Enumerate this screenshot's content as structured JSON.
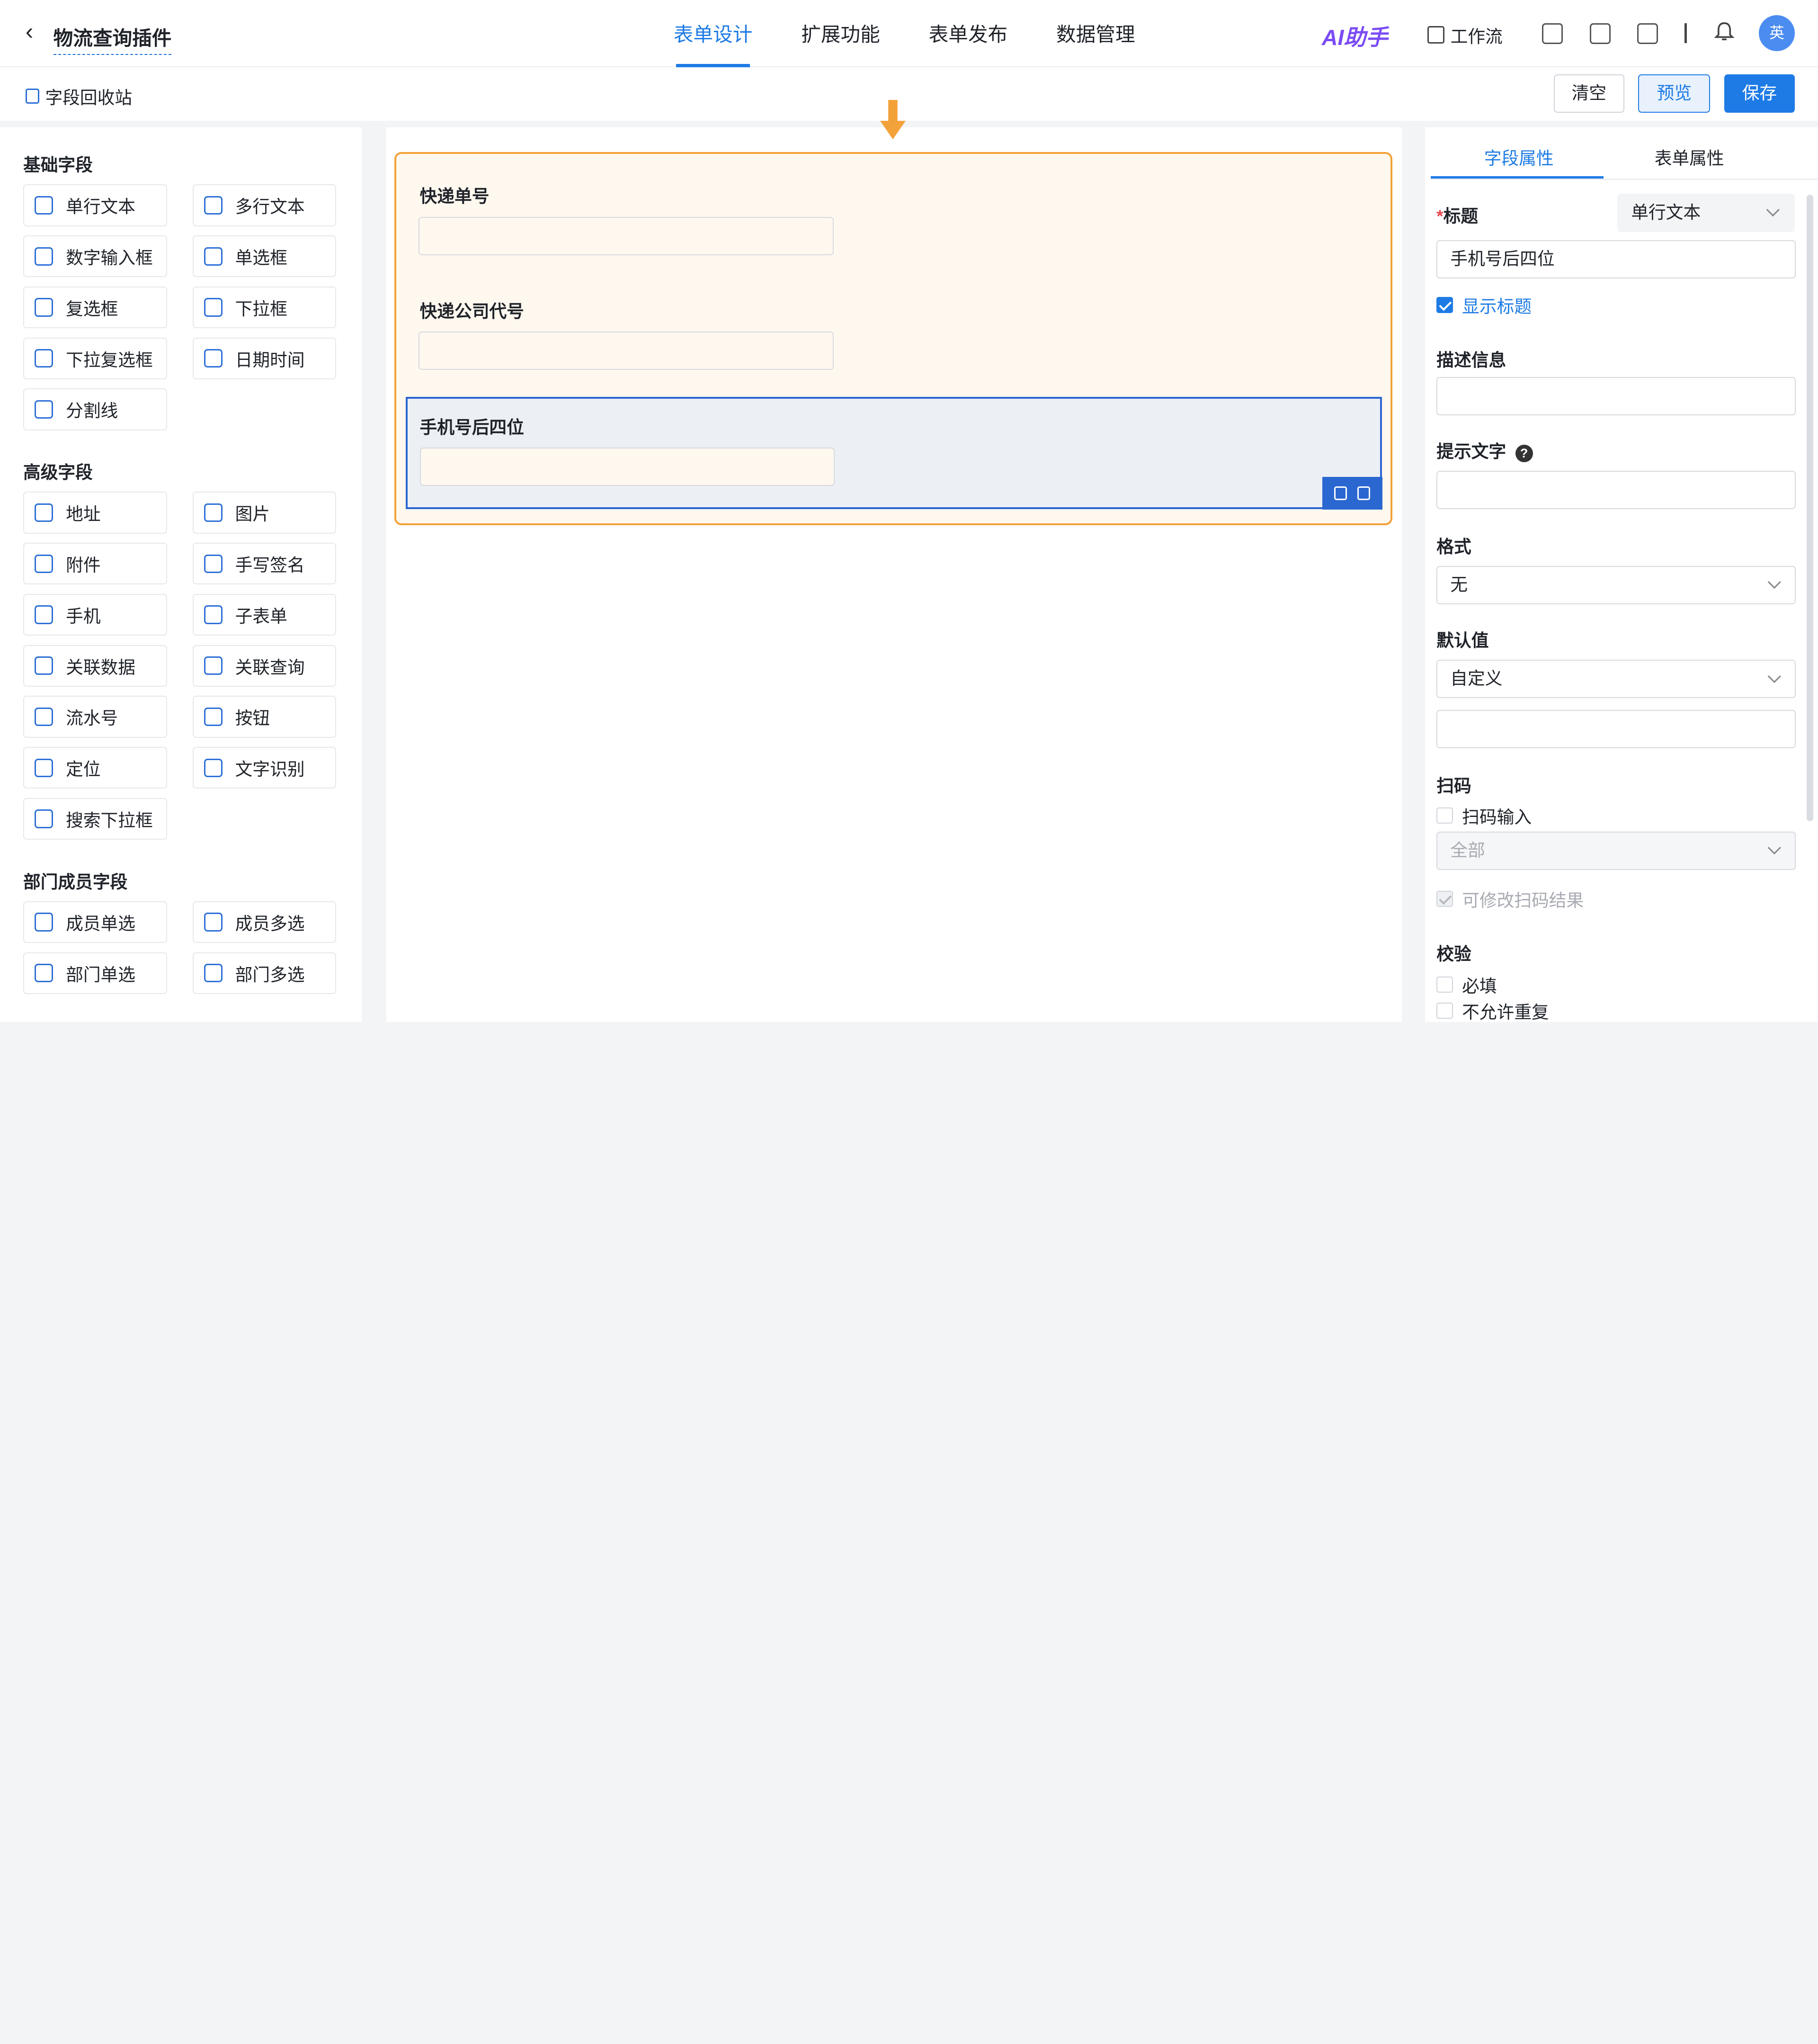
{
  "header": {
    "back_icon": "chevron-left-icon",
    "title": "物流查询插件",
    "tabs": [
      {
        "label": "表单设计",
        "active": true
      },
      {
        "label": "扩展功能",
        "active": false
      },
      {
        "label": "表单发布",
        "active": false
      },
      {
        "label": "数据管理",
        "active": false
      }
    ],
    "ai_label": "AI助手",
    "workflow_label": "工作流",
    "avatar_text": "英"
  },
  "subbar": {
    "recycle_label": "字段回收站",
    "clear_label": "清空",
    "preview_label": "预览",
    "save_label": "保存"
  },
  "left_panel": {
    "groups": [
      {
        "title": "基础字段",
        "items": [
          "单行文本",
          "多行文本",
          "数字输入框",
          "单选框",
          "复选框",
          "下拉框",
          "下拉复选框",
          "日期时间",
          "分割线"
        ]
      },
      {
        "title": "高级字段",
        "items": [
          "地址",
          "图片",
          "附件",
          "手写签名",
          "手机",
          "子表单",
          "关联数据",
          "关联查询",
          "流水号",
          "按钮",
          "定位",
          "文字识别",
          "搜索下拉框"
        ]
      },
      {
        "title": "部门成员字段",
        "items": [
          "成员单选",
          "成员多选",
          "部门单选",
          "部门多选"
        ]
      }
    ]
  },
  "canvas": {
    "fields": [
      {
        "label": "快递单号",
        "value": ""
      },
      {
        "label": "快递公司代号",
        "value": ""
      },
      {
        "label": "手机号后四位",
        "value": "",
        "selected": true
      }
    ]
  },
  "right_panel": {
    "tabs": [
      {
        "label": "字段属性",
        "active": true
      },
      {
        "label": "表单属性",
        "active": false
      }
    ],
    "title_label": "标题",
    "title_required_mark": "*",
    "field_type": "单行文本",
    "title_value": "手机号后四位",
    "show_title_label": "显示标题",
    "show_title_checked": true,
    "desc_label": "描述信息",
    "desc_value": "",
    "hint_label": "提示文字",
    "hint_value": "",
    "format_label": "格式",
    "format_value": "无",
    "default_label": "默认值",
    "default_mode": "自定义",
    "default_value": "",
    "scan_label": "扫码",
    "scan_input_label": "扫码输入",
    "scan_input_checked": false,
    "scan_scope": "全部",
    "scan_modify_label": "可修改扫码结果",
    "validate_label": "校验",
    "required_label": "必填",
    "no_repeat_label": "不允许重复"
  },
  "colors": {
    "accent": "#1e7be5",
    "form_border": "#f3a23a",
    "selected_border": "#2b67d1",
    "ai": "#7b4cf5"
  }
}
